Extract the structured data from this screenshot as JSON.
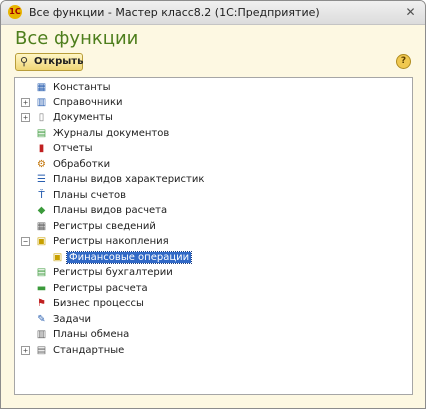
{
  "window": {
    "title": "Все функции - Мастер класс8.2  (1С:Предприятие)",
    "app_icon_text": "1C",
    "close_glyph": "✕"
  },
  "header": {
    "title": "Все функции"
  },
  "toolbar": {
    "open_label": "Открыть",
    "open_icon": "search-icon",
    "help_label": "?"
  },
  "tree": {
    "items": [
      {
        "label": "Константы",
        "icon": "constants-icon",
        "expandable": false,
        "level": 0
      },
      {
        "label": "Справочники",
        "icon": "catalogs-icon",
        "expandable": true,
        "level": 0
      },
      {
        "label": "Документы",
        "icon": "documents-icon",
        "expandable": true,
        "level": 0
      },
      {
        "label": "Журналы документов",
        "icon": "document-journals-icon",
        "expandable": false,
        "level": 0
      },
      {
        "label": "Отчеты",
        "icon": "reports-icon",
        "expandable": false,
        "level": 0
      },
      {
        "label": "Обработки",
        "icon": "processing-icon",
        "expandable": false,
        "level": 0
      },
      {
        "label": "Планы видов характеристик",
        "icon": "characteristic-types-icon",
        "expandable": false,
        "level": 0
      },
      {
        "label": "Планы счетов",
        "icon": "chart-of-accounts-icon",
        "expandable": false,
        "level": 0
      },
      {
        "label": "Планы видов расчета",
        "icon": "calculation-types-icon",
        "expandable": false,
        "level": 0
      },
      {
        "label": "Регистры сведений",
        "icon": "information-registers-icon",
        "expandable": false,
        "level": 0
      },
      {
        "label": "Регистры накопления",
        "icon": "accumulation-registers-icon",
        "expandable": true,
        "expanded": true,
        "level": 0
      },
      {
        "label": "Финансовые операции",
        "icon": "accumulation-register-icon",
        "expandable": false,
        "level": 1,
        "selected": true
      },
      {
        "label": "Регистры бухгалтерии",
        "icon": "accounting-registers-icon",
        "expandable": false,
        "level": 0
      },
      {
        "label": "Регистры расчета",
        "icon": "calculation-registers-icon",
        "expandable": false,
        "level": 0
      },
      {
        "label": "Бизнес процессы",
        "icon": "business-processes-icon",
        "expandable": false,
        "level": 0
      },
      {
        "label": "Задачи",
        "icon": "tasks-icon",
        "expandable": false,
        "level": 0
      },
      {
        "label": "Планы обмена",
        "icon": "exchange-plans-icon",
        "expandable": false,
        "level": 0
      },
      {
        "label": "Стандартные",
        "icon": "standard-icon",
        "expandable": true,
        "level": 0
      }
    ]
  }
}
